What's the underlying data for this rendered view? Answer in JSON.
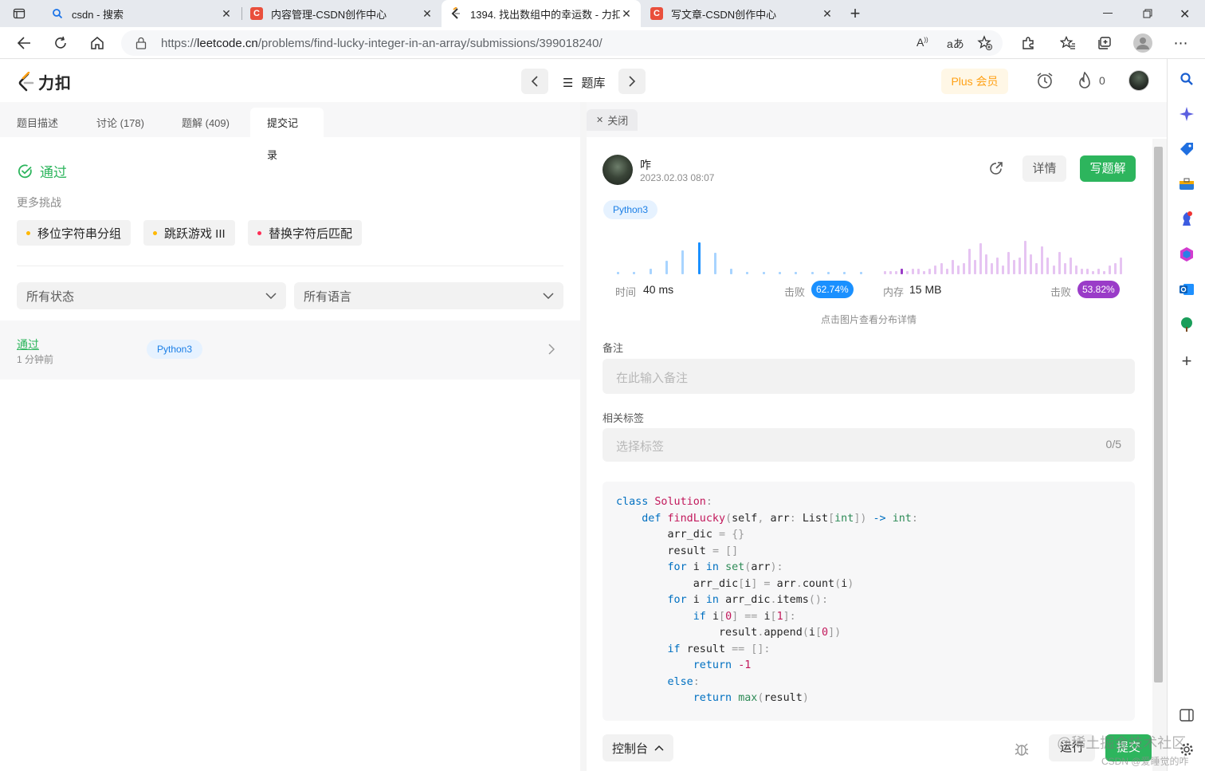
{
  "browser": {
    "tabs": [
      {
        "title": "csdn - 搜索",
        "favicon": "search-icon"
      },
      {
        "title": "内容管理-CSDN创作中心",
        "favicon": "csdn-icon"
      },
      {
        "title": "1394. 找出数组中的幸运数 - 力扣",
        "favicon": "leetcode-icon"
      },
      {
        "title": "写文章-CSDN创作中心",
        "favicon": "csdn-icon"
      }
    ],
    "url_prefix": "https://",
    "url_host": "leetcode.cn",
    "url_path": "/problems/find-lucky-integer-in-an-array/submissions/399018240/",
    "csdn_letter": "C",
    "new_tab": "+"
  },
  "header": {
    "logo_text": "力扣",
    "problem_list": "题库",
    "plus": "Plus 会员",
    "streak": "0"
  },
  "left": {
    "tabs": [
      "题目描述",
      "讨论 (178)",
      "题解 (409)",
      "提交记录"
    ],
    "status": "通过",
    "more_label": "更多挑战",
    "challenges": [
      {
        "label": "移位字符串分组",
        "color": "#ffb800"
      },
      {
        "label": "跳跃游戏 III",
        "color": "#ffb800"
      },
      {
        "label": "替换字符后匹配",
        "color": "#ff2d55"
      }
    ],
    "filter_status": "所有状态",
    "filter_lang": "所有语言",
    "submission": {
      "status": "通过",
      "time": "1 分钟前",
      "lang": "Python3"
    }
  },
  "right": {
    "close": "关闭",
    "user": "咋",
    "date": "2023.02.03 08:07",
    "details": "详情",
    "write": "写题解",
    "lang": "Python3",
    "runtime": {
      "label": "时间",
      "value": "40 ms",
      "beats_label": "击败",
      "beats": "62.74%"
    },
    "memory": {
      "label": "内存",
      "value": "15 MB",
      "beats_label": "击败",
      "beats": "53.82%"
    },
    "dist_hint": "点击图片查看分布详情",
    "note_label": "备注",
    "note_placeholder": "在此输入备注",
    "tags_label": "相关标签",
    "tags_placeholder": "选择标签",
    "tags_count": "0/5",
    "console": "控制台",
    "run": "运行",
    "submit": "提交"
  },
  "chart_data": [
    {
      "type": "bar",
      "title": "时间",
      "values": [
        1,
        1,
        2,
        5,
        9,
        12,
        8,
        2,
        1,
        1,
        1,
        1,
        1,
        1,
        1,
        1
      ],
      "highlight_index": 5,
      "color": "#a8d4ff",
      "highlight_color": "#1a90ff"
    },
    {
      "type": "bar",
      "title": "内存",
      "values": [
        1,
        1,
        1,
        2,
        1,
        2,
        2,
        1,
        2,
        3,
        4,
        2,
        5,
        3,
        4,
        9,
        5,
        11,
        7,
        4,
        6,
        3,
        8,
        5,
        6,
        12,
        7,
        4,
        10,
        6,
        3,
        8,
        4,
        6,
        3,
        2,
        2,
        1,
        2,
        1,
        3,
        4,
        6
      ],
      "highlight_index": 3,
      "color": "#e6c4f2",
      "highlight_color": "#9a3cc8"
    }
  ],
  "code_lines": [
    [
      [
        "kw",
        "class "
      ],
      [
        "cl",
        "Solution"
      ],
      [
        "pu",
        ":"
      ]
    ],
    [
      [
        "",
        "    "
      ],
      [
        "kw",
        "def "
      ],
      [
        "fn",
        "findLucky"
      ],
      [
        "pu",
        "("
      ],
      [
        "",
        "self"
      ],
      [
        "pu",
        ", "
      ],
      [
        "",
        "arr"
      ],
      [
        "pu",
        ": "
      ],
      [
        "",
        "List"
      ],
      [
        "pu",
        "["
      ],
      [
        "bi",
        "int"
      ],
      [
        "pu",
        "]) "
      ],
      [
        "kw",
        "-> "
      ],
      [
        "bi",
        "int"
      ],
      [
        "pu",
        ":"
      ]
    ],
    [
      [
        "",
        "        arr_dic "
      ],
      [
        "pu",
        "= {}"
      ]
    ],
    [
      [
        "",
        "        result "
      ],
      [
        "pu",
        "= []"
      ]
    ],
    [
      [
        "",
        "        "
      ],
      [
        "kw",
        "for "
      ],
      [
        "",
        "i "
      ],
      [
        "kw",
        "in "
      ],
      [
        "bi",
        "set"
      ],
      [
        "pu",
        "("
      ],
      [
        "",
        "arr"
      ],
      [
        "pu",
        "):"
      ]
    ],
    [
      [
        "",
        "            arr_dic"
      ],
      [
        "pu",
        "["
      ],
      [
        "",
        "i"
      ],
      [
        "pu",
        "] = "
      ],
      [
        "",
        "arr"
      ],
      [
        "pu",
        "."
      ],
      [
        "",
        "count"
      ],
      [
        "pu",
        "("
      ],
      [
        "",
        "i"
      ],
      [
        "pu",
        ")"
      ]
    ],
    [
      [
        "",
        "        "
      ],
      [
        "kw",
        "for "
      ],
      [
        "",
        "i "
      ],
      [
        "kw",
        "in "
      ],
      [
        "",
        "arr_dic"
      ],
      [
        "pu",
        "."
      ],
      [
        "",
        "items"
      ],
      [
        "pu",
        "():"
      ]
    ],
    [
      [
        "",
        "            "
      ],
      [
        "kw",
        "if "
      ],
      [
        "",
        "i"
      ],
      [
        "pu",
        "["
      ],
      [
        "nu",
        "0"
      ],
      [
        "pu",
        "] == "
      ],
      [
        "",
        "i"
      ],
      [
        "pu",
        "["
      ],
      [
        "nu",
        "1"
      ],
      [
        "pu",
        "]:"
      ]
    ],
    [
      [
        "",
        "                result"
      ],
      [
        "pu",
        "."
      ],
      [
        "",
        "append"
      ],
      [
        "pu",
        "("
      ],
      [
        "",
        "i"
      ],
      [
        "pu",
        "["
      ],
      [
        "nu",
        "0"
      ],
      [
        "pu",
        "])"
      ]
    ],
    [
      [
        "",
        "        "
      ],
      [
        "kw",
        "if "
      ],
      [
        "",
        "result "
      ],
      [
        "pu",
        "== []:"
      ]
    ],
    [
      [
        "",
        "            "
      ],
      [
        "kw",
        "return "
      ],
      [
        "nu",
        "-1"
      ]
    ],
    [
      [
        "",
        "        "
      ],
      [
        "kw",
        "else"
      ],
      [
        "pu",
        ":"
      ]
    ],
    [
      [
        "",
        "            "
      ],
      [
        "kw",
        "return "
      ],
      [
        "bi",
        "max"
      ],
      [
        "pu",
        "("
      ],
      [
        "",
        "result"
      ],
      [
        "pu",
        ")"
      ]
    ]
  ],
  "watermark": "@稀土掘金技术社区",
  "watermark2": "CSDN @爱睡觉的咋"
}
